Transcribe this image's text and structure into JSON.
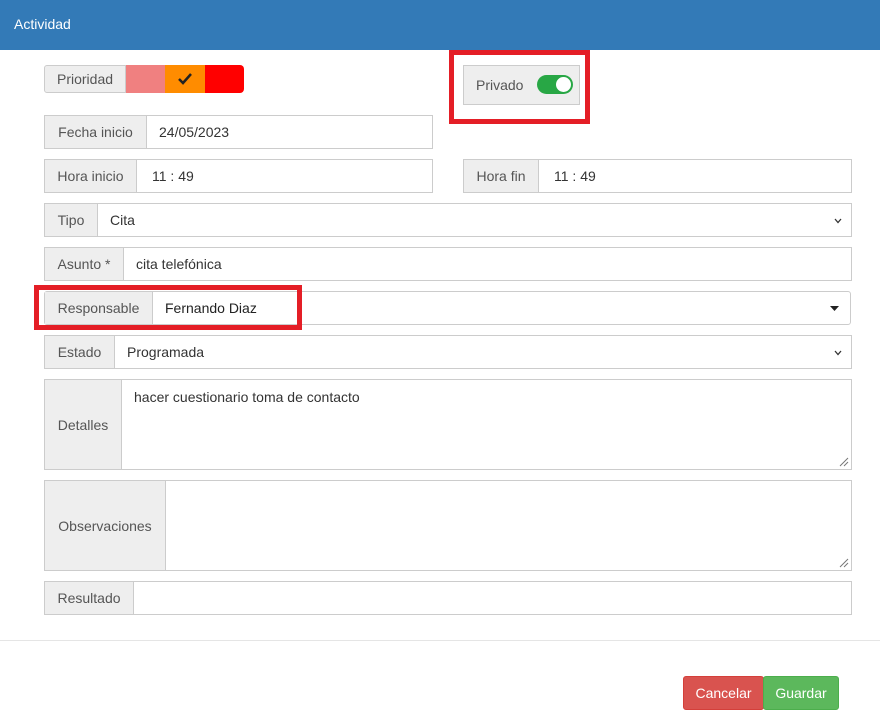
{
  "header": {
    "title": "Actividad"
  },
  "prioridad": {
    "label": "Prioridad",
    "colors": [
      "#f08080",
      "#ff8c00",
      "#ff0000"
    ],
    "selected": 1
  },
  "privado": {
    "label": "Privado",
    "on": true
  },
  "fecha_inicio": {
    "label": "Fecha inicio",
    "value": "24/05/2023"
  },
  "hora_inicio": {
    "label": "Hora inicio",
    "value": "11 : 49"
  },
  "hora_fin": {
    "label": "Hora fin",
    "value": "11 : 49"
  },
  "tipo": {
    "label": "Tipo",
    "value": "Cita"
  },
  "asunto": {
    "label": "Asunto *",
    "value": "cita telefónica"
  },
  "responsable": {
    "label": "Responsable",
    "value": "Fernando Diaz"
  },
  "estado": {
    "label": "Estado",
    "value": "Programada"
  },
  "detalles": {
    "label": "Detalles",
    "value": "hacer cuestionario toma de contacto"
  },
  "observaciones": {
    "label": "Observaciones",
    "value": ""
  },
  "resultado": {
    "label": "Resultado",
    "value": ""
  },
  "footer": {
    "cancel_label": "Cancelar",
    "save_label": "Guardar"
  },
  "colors": {
    "header": "#337ab7",
    "toggle_on": "#28a745",
    "highlight": "#e41e26",
    "cancel": "#d9534f",
    "save": "#5cb85c"
  }
}
